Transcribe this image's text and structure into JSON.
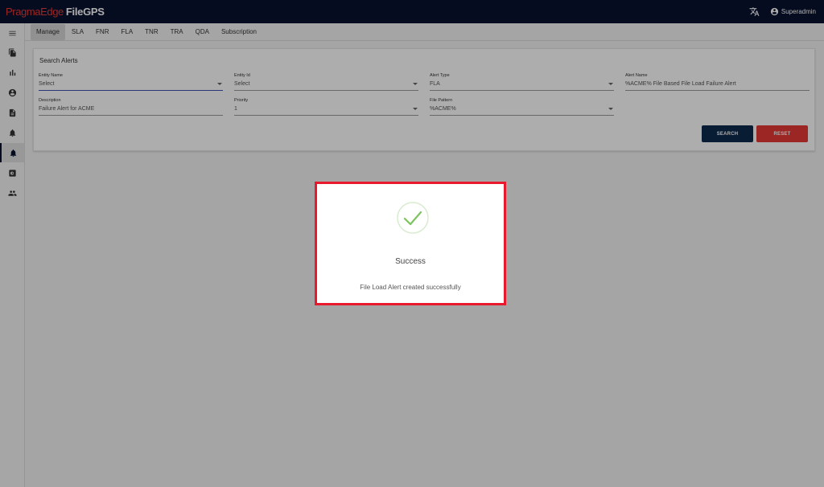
{
  "brand": {
    "prefix": "PragmaEdge",
    "app": "FileGPS"
  },
  "topbar": {
    "user_name": "Superadmin",
    "translate_icon": "translate-icon",
    "user_icon": "account-circle-icon"
  },
  "sidenav": {
    "items": [
      {
        "icon": "menu-icon"
      },
      {
        "icon": "copy-file-icon"
      },
      {
        "icon": "bar-chart-icon"
      },
      {
        "icon": "account-circle-icon"
      },
      {
        "icon": "document-icon"
      },
      {
        "icon": "bell-alert-icon"
      },
      {
        "icon": "bell-alert-icon",
        "active": true
      },
      {
        "icon": "settings-box-icon"
      },
      {
        "icon": "people-icon"
      }
    ]
  },
  "tabs": [
    {
      "label": "Manage",
      "active": true
    },
    {
      "label": "SLA"
    },
    {
      "label": "FNR"
    },
    {
      "label": "FLA"
    },
    {
      "label": "TNR"
    },
    {
      "label": "TRA"
    },
    {
      "label": "QDA"
    },
    {
      "label": "Subscription"
    }
  ],
  "search": {
    "title": "Search Alerts",
    "entity_name": {
      "label": "Entity Name",
      "value": "Select"
    },
    "entity_id": {
      "label": "Entity Id",
      "value": "Select"
    },
    "alert_type": {
      "label": "Alert Type",
      "value": "FLA"
    },
    "alert_name": {
      "label": "Alert Name",
      "value": "%ACME% File Based File Load Failure Alert"
    },
    "description": {
      "label": "Description",
      "value": "Failure Alert for ACME"
    },
    "priority": {
      "label": "Priority",
      "value": "1"
    },
    "file_pattern": {
      "label": "File Pattern",
      "value": "%ACME%"
    },
    "search_label": "SEARCH",
    "reset_label": "RESET"
  },
  "dialog": {
    "title": "Success",
    "message": "File Load Alert created successfully",
    "icon": "check-icon"
  },
  "colors": {
    "topbar": "#0a1230",
    "brand_red": "#e53935",
    "search_button": "#0d2a4d",
    "reset_button": "#e53935",
    "dialog_border": "#e8192c",
    "check_green": "#7cc45e"
  }
}
